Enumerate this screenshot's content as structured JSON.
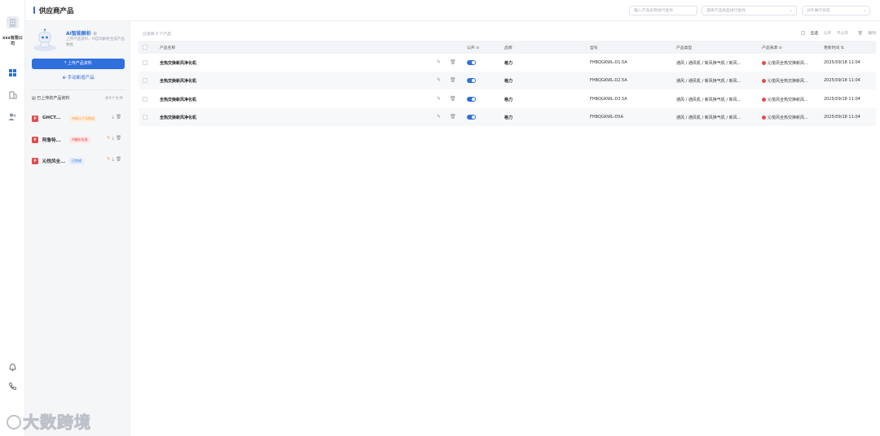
{
  "sidebar": {
    "company_name": "xxx有限公司",
    "nav_icons": [
      "building-icon",
      "grid-icon",
      "office-icon",
      "users-icon",
      "bell-icon",
      "phone-icon"
    ]
  },
  "header": {
    "title": "供应商产品",
    "search_placeholder": "输入产品名称进行查找",
    "type_select_placeholder": "选择产品类型进行查找",
    "visibility_select_placeholder": "对外展示状态"
  },
  "panel": {
    "ai_title": "AI智能解析",
    "ai_desc": "上传产品资料，AI自动解析生成产品数据",
    "upload_button": "上传产品资料",
    "manual_button": "手动新增产品",
    "uploaded_header": "已上传的产品资料",
    "uploaded_count": "共3个文件",
    "files": [
      {
        "name": "GHCT...",
        "badge": "待确认产品数据",
        "badge_color": "#f5a04a",
        "badge_bg": "#fdf0e2"
      },
      {
        "name": "阿鲁特...",
        "badge": "AI解析失败",
        "badge_color": "#e34b4b",
        "badge_bg": "#fde6e6"
      },
      {
        "name": "沁悦风全...",
        "badge": "已完成",
        "badge_color": "#2f6fde",
        "badge_bg": "#e4edfc"
      }
    ]
  },
  "main": {
    "selected_text": "已选择 0 个产品",
    "toolbar": {
      "select_all": "全选",
      "public": "公开",
      "private": "不公开",
      "delete": "删除"
    },
    "columns": {
      "name": "产品名称",
      "public": "公开",
      "brand": "品牌",
      "model": "型号",
      "type": "产品类型",
      "source": "产品来源",
      "updated": "更新时间"
    },
    "rows": [
      {
        "name": "全热交换新风净化机",
        "brand": "格力",
        "model": "FHBQGKWL-D1.5A",
        "type": "通风 / 通风机 / 新风换气机 / 新风...",
        "source": "沁悦风全热交换新风...",
        "updated": "2025/09/18 11:04"
      },
      {
        "name": "全热交换新风净化机",
        "brand": "格力",
        "model": "FHBQGKWL-D2.5A",
        "type": "通风 / 通风机 / 新风换气机 / 新风...",
        "source": "沁悦风全热交换新风...",
        "updated": "2025/09/18 11:04"
      },
      {
        "name": "全热交换新风净化机",
        "brand": "格力",
        "model": "FHBQGKWL-D3.5A",
        "type": "通风 / 通风机 / 新风换气机 / 新风...",
        "source": "沁悦风全热交换新风...",
        "updated": "2025/09/18 11:04"
      },
      {
        "name": "全热交换新风净化机",
        "brand": "格力",
        "model": "FHBQGKWL-D5A",
        "type": "通风 / 通风机 / 新风换气机 / 新风...",
        "source": "沁悦风全热交换新风...",
        "updated": "2025/09/18 11:04"
      }
    ]
  },
  "watermark": "大数跨境"
}
